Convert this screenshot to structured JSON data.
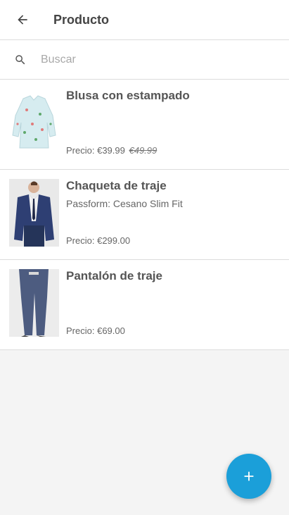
{
  "appbar": {
    "title": "Producto"
  },
  "search": {
    "placeholder": "Buscar",
    "value": ""
  },
  "products": [
    {
      "title": "Blusa con estampado",
      "subtitle": "",
      "price_label": "Precio:",
      "price": "€39.99",
      "old_price": "€49.99",
      "image": "blouse-print"
    },
    {
      "title": "Chaqueta de traje",
      "subtitle": "Passform: Cesano Slim Fit",
      "price_label": "Precio:",
      "price": "€299.00",
      "old_price": "",
      "image": "suit-jacket"
    },
    {
      "title": "Pantalón de traje",
      "subtitle": "",
      "price_label": "Precio:",
      "price": "€69.00",
      "old_price": "",
      "image": "suit-trousers"
    }
  ],
  "colors": {
    "accent": "#1b9fd9",
    "background": "#f4f4f4",
    "surface": "#ffffff"
  },
  "icons": {
    "back": "arrow-left-icon",
    "search": "search-icon",
    "fab": "plus-icon"
  }
}
